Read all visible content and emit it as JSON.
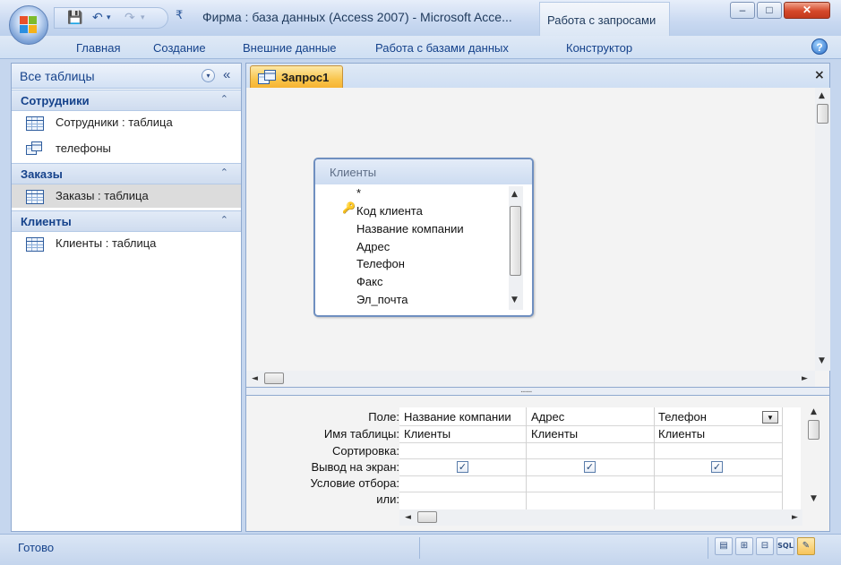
{
  "window": {
    "title": "Фирма : база данных (Access 2007) - Microsoft Acce...",
    "context_tab": "Работа с запросами",
    "controls": {
      "minimize": "–",
      "maximize": "□",
      "close": "✕"
    }
  },
  "qat": {
    "save": "💾",
    "undo": "↶",
    "redo": "↷",
    "sep": "▾",
    "customize": "₹"
  },
  "ribbon": {
    "tabs": [
      "Главная",
      "Создание",
      "Внешние данные",
      "Работа с базами данных",
      "Конструктор"
    ],
    "help": "?"
  },
  "nav": {
    "title": "Все таблицы",
    "dropdown": "▾",
    "collapse": "«",
    "groups": [
      {
        "label": "Сотрудники",
        "collapse": "⌃",
        "items": [
          {
            "label": "Сотрудники : таблица",
            "icon": "table-icon"
          },
          {
            "label": "телефоны",
            "icon": "query-icon"
          }
        ]
      },
      {
        "label": "Заказы",
        "collapse": "⌃",
        "items": [
          {
            "label": "Заказы : таблица",
            "icon": "table-icon",
            "selected": true
          }
        ]
      },
      {
        "label": "Клиенты",
        "collapse": "⌃",
        "items": [
          {
            "label": "Клиенты : таблица",
            "icon": "table-icon"
          }
        ]
      }
    ]
  },
  "document": {
    "tab_label": "Запрос1",
    "close": "×"
  },
  "field_list": {
    "title": "Клиенты",
    "fields": [
      "*",
      "Код клиента",
      "Название компании",
      "Адрес",
      "Телефон",
      "Факс",
      "Эл_почта"
    ],
    "key_icon": "🔑"
  },
  "scroll": {
    "up": "▲",
    "down": "▼",
    "left": "◄",
    "right": "►"
  },
  "splitter": {
    "grip": "......."
  },
  "qbe": {
    "row_labels": [
      "Поле:",
      "Имя таблицы:",
      "Сортировка:",
      "Вывод на экран:",
      "Условие отбора:",
      "или:"
    ],
    "columns": [
      {
        "field": "Название компании",
        "table": "Клиенты",
        "show": true
      },
      {
        "field": "Адрес",
        "table": "Клиенты",
        "show": true
      },
      {
        "field": "Телефон",
        "table": "Клиенты",
        "show": true
      }
    ],
    "check_mark": "✓",
    "combo_arrow": "▼"
  },
  "status": {
    "text": "Готово",
    "view_buttons": [
      "▤",
      "⊞",
      "⊟",
      "SQL",
      "✎"
    ]
  },
  "colors": {
    "accent": "#15428b",
    "tab_active": "#f9c44a",
    "frame": "#8fa9cf"
  }
}
